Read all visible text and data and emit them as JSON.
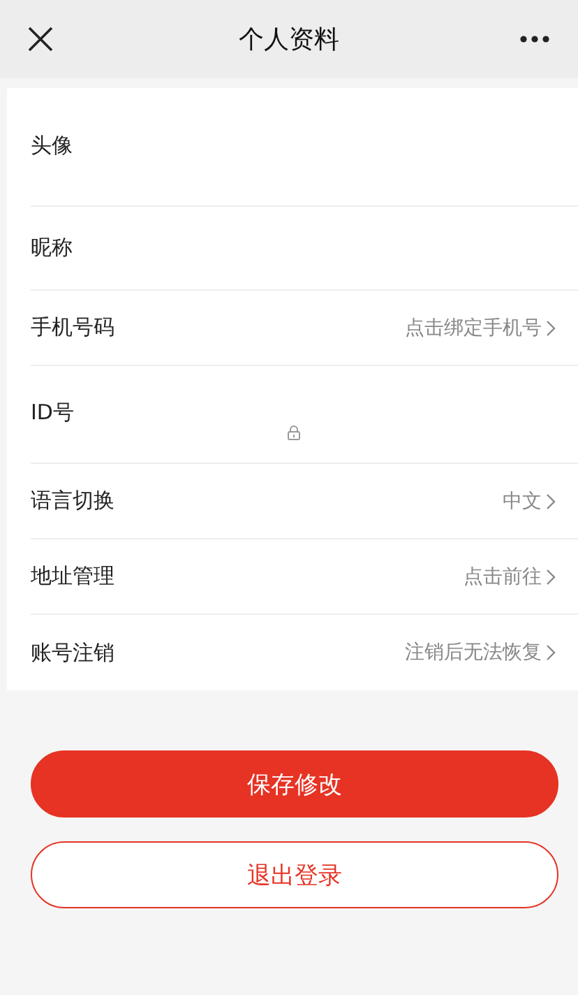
{
  "header": {
    "title": "个人资料"
  },
  "rows": [
    {
      "kind": "avatar",
      "label": "头像"
    },
    {
      "kind": "plain",
      "label": "昵称"
    },
    {
      "kind": "link",
      "label": "手机号码",
      "value": "点击绑定手机号"
    },
    {
      "kind": "locked",
      "label": "ID号"
    },
    {
      "kind": "link",
      "label": "语言切换",
      "value": "中文"
    },
    {
      "kind": "link",
      "label": "地址管理",
      "value": "点击前往"
    },
    {
      "kind": "link",
      "label": "账号注销",
      "value": "注销后无法恢复"
    }
  ],
  "buttons": [
    {
      "kind": "primary",
      "label": "保存修改"
    },
    {
      "kind": "outline",
      "label": "退出登录"
    }
  ]
}
